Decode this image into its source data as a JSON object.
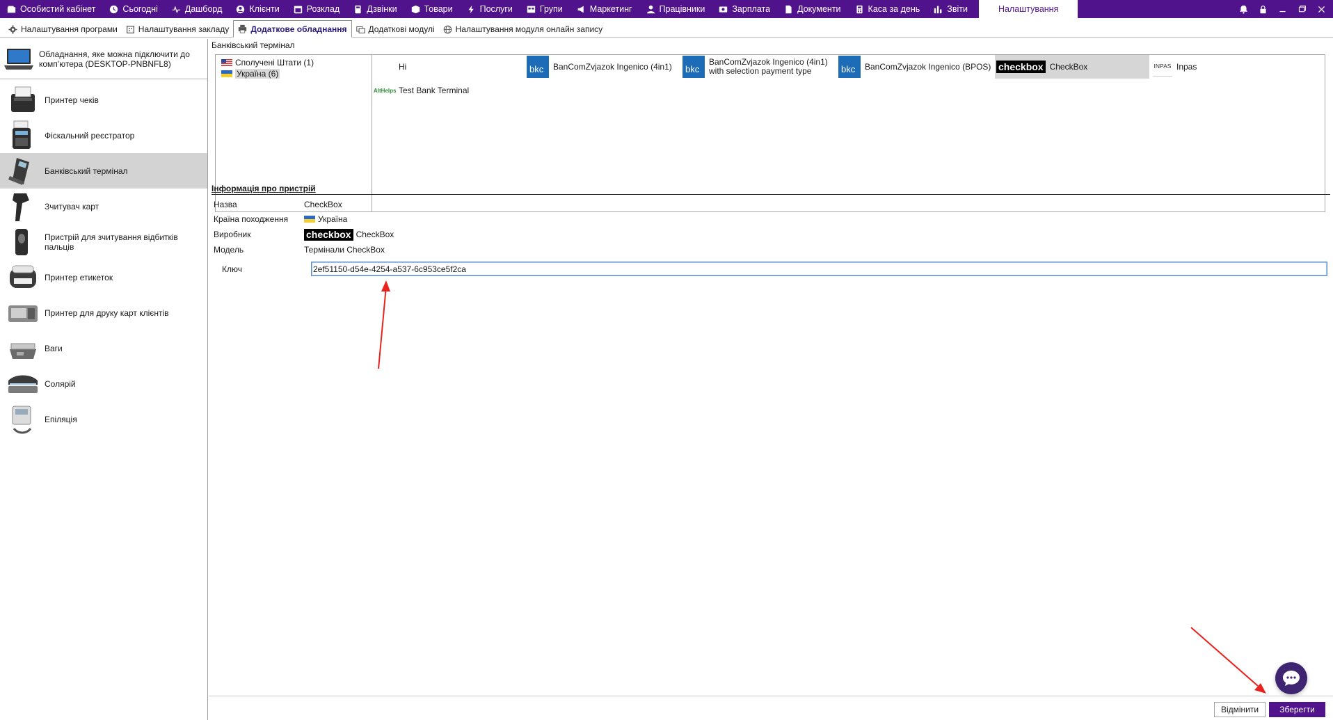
{
  "topnav": {
    "items": [
      {
        "label": "Особистий кабінет",
        "icon": "wallet-icon"
      },
      {
        "label": "Сьогодні",
        "icon": "clock-icon"
      },
      {
        "label": "Дашборд",
        "icon": "pulse-icon"
      },
      {
        "label": "Клієнти",
        "icon": "user-icon"
      },
      {
        "label": "Розклад",
        "icon": "calendar-icon"
      },
      {
        "label": "Дзвінки",
        "icon": "phone-icon"
      },
      {
        "label": "Товари",
        "icon": "box-icon"
      },
      {
        "label": "Послуги",
        "icon": "lightning-icon"
      },
      {
        "label": "Групи",
        "icon": "group-icon"
      },
      {
        "label": "Маркетинг",
        "icon": "megaphone-icon"
      },
      {
        "label": "Працівники",
        "icon": "employee-icon"
      },
      {
        "label": "Зарплата",
        "icon": "money-icon"
      },
      {
        "label": "Документи",
        "icon": "document-icon"
      },
      {
        "label": "Каса за день",
        "icon": "calculator-icon"
      },
      {
        "label": "Звіти",
        "icon": "bar-chart-icon"
      }
    ],
    "active_label": "Налаштування"
  },
  "subtabs": [
    {
      "label": "Налаштування програми",
      "icon": "gear-icon",
      "active": false
    },
    {
      "label": "Налаштування закладу",
      "icon": "building-icon",
      "active": false
    },
    {
      "label": "Додаткове обладнання",
      "icon": "printer-icon",
      "active": true
    },
    {
      "label": "Додаткові модулі",
      "icon": "modules-icon",
      "active": false
    },
    {
      "label": "Налаштування модуля онлайн запису",
      "icon": "globe-icon",
      "active": false
    }
  ],
  "left_panel": {
    "pc_text": "Обладнання, яке можна підключити до комп'ютера (DESKTOP-PNBNFL8)",
    "devices": [
      {
        "label": "Принтер чеків",
        "icon": "receipt-printer-icon"
      },
      {
        "label": "Фіскальний реєстратор",
        "icon": "fiscal-register-icon"
      },
      {
        "label": "Банківський термінал",
        "icon": "bank-terminal-icon",
        "selected": true
      },
      {
        "label": "Зчитувач карт",
        "icon": "card-reader-icon"
      },
      {
        "label": "Пристрій для зчитування відбитків пальців",
        "icon": "fingerprint-scanner-icon"
      },
      {
        "label": "Принтер етикеток",
        "icon": "label-printer-icon"
      },
      {
        "label": "Принтер для друку карт клієнтів",
        "icon": "card-printer-icon"
      },
      {
        "label": "Ваги",
        "icon": "scales-icon"
      },
      {
        "label": "Солярій",
        "icon": "solarium-icon"
      },
      {
        "label": "Епіляція",
        "icon": "epilation-icon"
      }
    ]
  },
  "section_title": "Банківський термінал",
  "countries": [
    {
      "label": "Сполучені Штати (1)",
      "flag": "us-flag-icon"
    },
    {
      "label": "Україна (6)",
      "flag": "ua-flag-icon",
      "selected": true
    }
  ],
  "vendors": [
    {
      "label": "Hi"
    },
    {
      "label": "BanComZvjazok Ingenico (4in1)",
      "logo": "bkc-logo-icon"
    },
    {
      "label": "BanComZvjazok Ingenico (4in1) with selection payment type",
      "logo": "bkc-logo-icon"
    },
    {
      "label": "BanComZvjazok Ingenico (BPOS)",
      "logo": "bkc-logo-icon"
    },
    {
      "label": "CheckBox",
      "logo": "checkbox-logo-icon",
      "logo_text": "checkbox",
      "selected": true
    },
    {
      "label": "Inpas",
      "logo": "inpas-logo-icon",
      "logo_text": "INPAS"
    },
    {
      "label": "Test Bank Terminal",
      "logo": "altegio-logo-icon",
      "logo_text": "AltHelps"
    }
  ],
  "info": {
    "title": "Інформація про пристрій",
    "rows": [
      {
        "label": "Назва",
        "value": "CheckBox"
      },
      {
        "label": "Країна походження",
        "value": "Україна",
        "flag": "ua-flag-icon"
      },
      {
        "label": "Виробник",
        "value": "CheckBox",
        "logo_text": "checkbox"
      },
      {
        "label": "Модель",
        "value": "Термінали CheckBox"
      }
    ],
    "key_label": "Ключ",
    "key_value": "2ef51150-d54e-4254-a537-6c953ce5f2ca"
  },
  "buttons": {
    "cancel": "Відмінити",
    "save": "Зберегти"
  },
  "colors": {
    "brand": "#51138c",
    "annotation_arrow": "#e8231e",
    "chat": "#3f2472"
  }
}
